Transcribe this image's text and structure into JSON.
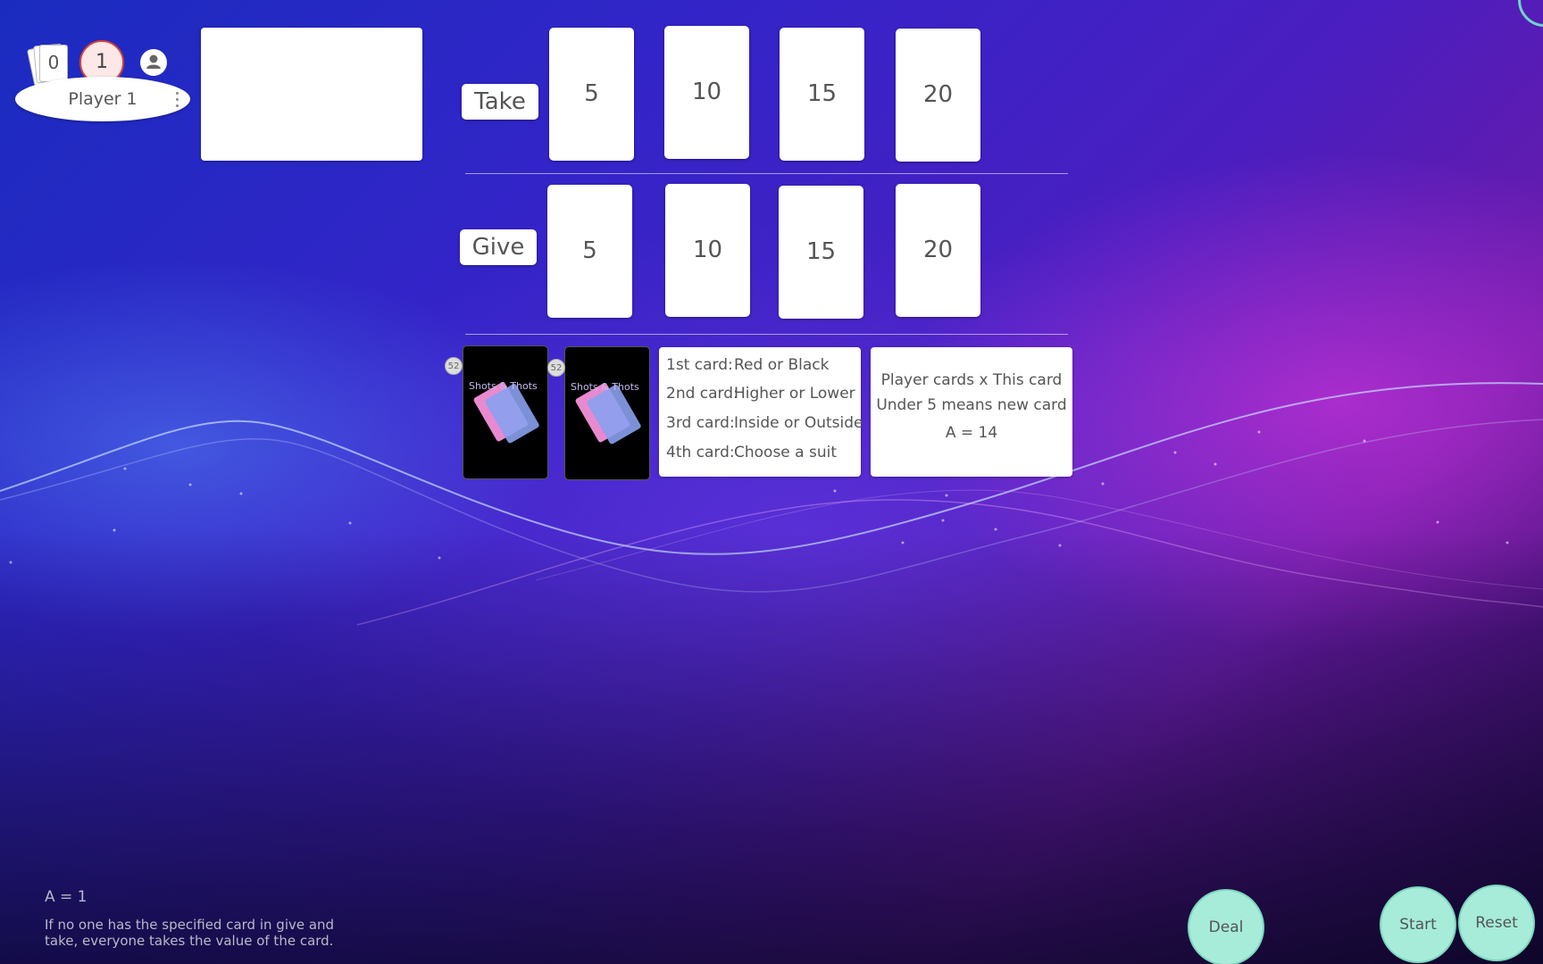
{
  "player": {
    "name": "Player 1",
    "cards_count": "0",
    "drink_count": "1",
    "icons": {
      "avatar": "user-icon",
      "menu": "kebab-menu-icon",
      "hand": "card-stack-icon"
    }
  },
  "take_row": {
    "label": "Take",
    "cards": [
      "5",
      "10",
      "15",
      "20"
    ]
  },
  "give_row": {
    "label": "Give",
    "cards": [
      "5",
      "10",
      "15",
      "20"
    ]
  },
  "decks": [
    {
      "count": "52",
      "image_text": "Shots & Thots"
    },
    {
      "count": "52",
      "image_text": "Shots & Thots"
    }
  ],
  "rules": [
    {
      "key": "1st card:",
      "value": "Red or Black"
    },
    {
      "key": "2nd card:",
      "value": "Higher or Lower"
    },
    {
      "key": "3rd card:",
      "value": "Inside or Outside"
    },
    {
      "key": "4th card:",
      "value": "Choose a suit"
    }
  ],
  "info": {
    "line1": "Player cards x This card",
    "line2": "Under 5 means new card",
    "line3": "A = 14"
  },
  "footnote": {
    "line1": "A = 1",
    "line2": "If no one has the specified card in give and",
    "line3": "take, everyone takes the value of the card."
  },
  "buttons": {
    "deal": "Deal",
    "start": "Start",
    "reset": "Reset"
  },
  "colors": {
    "button_bg": "#a6ecd9",
    "badge_border": "#d9412f"
  }
}
